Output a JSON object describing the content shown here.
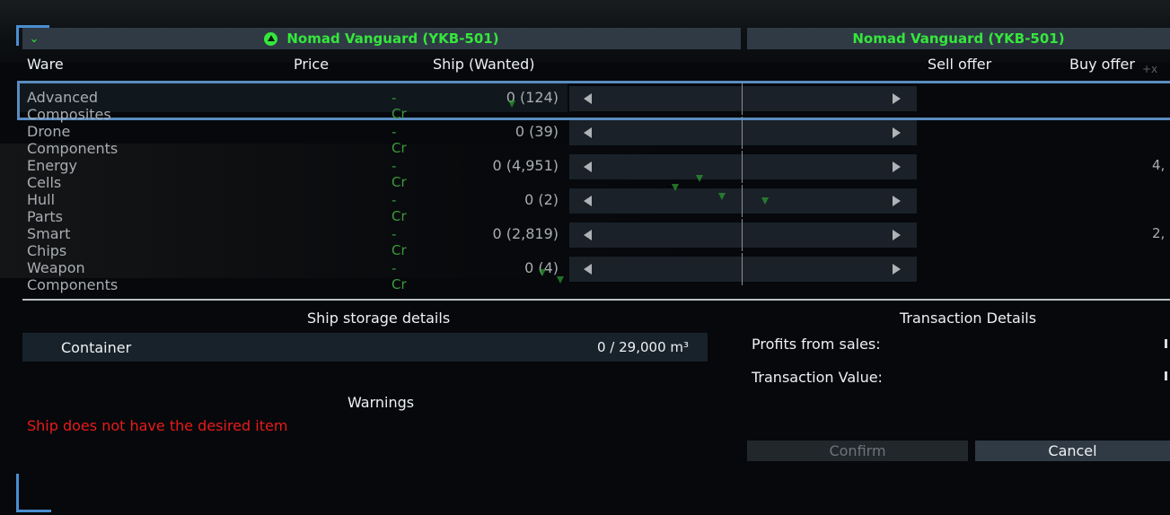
{
  "header": {
    "left_title": "Nomad Vanguard (YKB-501)",
    "right_title": "Nomad Vanguard (YKB-501)",
    "collapse_icon": "chevron-down-icon",
    "ship_icon": "ship-icon"
  },
  "columns": {
    "ware": "Ware",
    "price": "Price",
    "ship_wanted": "Ship (Wanted)",
    "sell_offer": "Sell offer",
    "buy_offer": "Buy offer"
  },
  "wares": [
    {
      "name": "Advanced Composites",
      "price": "- Cr",
      "qty": "0 (124)",
      "buy": ""
    },
    {
      "name": "Drone Components",
      "price": "- Cr",
      "qty": "0 (39)",
      "buy": ""
    },
    {
      "name": "Energy Cells",
      "price": "- Cr",
      "qty": "0 (4,951)",
      "buy": "4,"
    },
    {
      "name": "Hull Parts",
      "price": "- Cr",
      "qty": "0 (2)",
      "buy": ""
    },
    {
      "name": "Smart Chips",
      "price": "- Cr",
      "qty": "0 (2,819)",
      "buy": "2,"
    },
    {
      "name": "Weapon Components",
      "price": "- Cr",
      "qty": "0 (4)",
      "buy": ""
    }
  ],
  "storage": {
    "title": "Ship storage details",
    "container_label": "Container",
    "container_value": "0 / 29,000 m³"
  },
  "warnings": {
    "title": "Warnings",
    "message": "Ship does not have the desired item"
  },
  "transaction": {
    "title": "Transaction Details",
    "profits_label": "Profits from sales:",
    "value_label": "Transaction Value:"
  },
  "buttons": {
    "confirm": "Confirm",
    "cancel": "Cancel"
  },
  "colors": {
    "accent_green": "#35e63c",
    "header_bg": "#2f3a45",
    "warning_red": "#e81b1b",
    "selection_blue": "#5a8cc0"
  }
}
